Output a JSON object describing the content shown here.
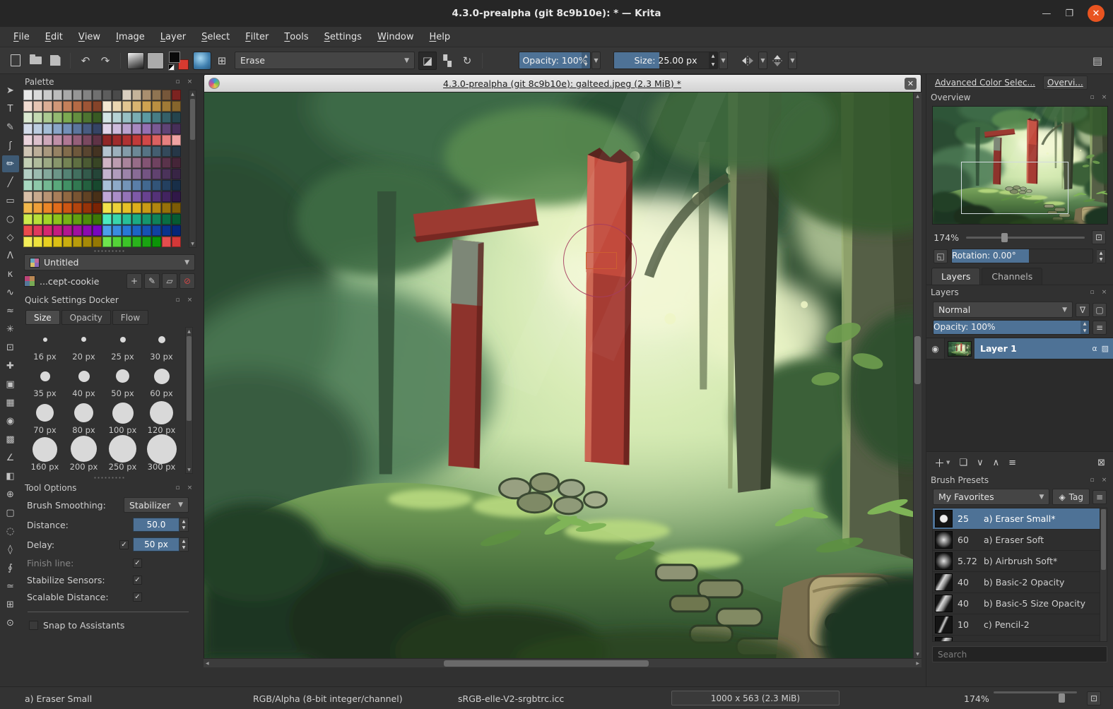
{
  "titlebar": {
    "title": "4.3.0-prealpha (git 8c9b10e): * — Krita"
  },
  "menubar": {
    "items": [
      "File",
      "Edit",
      "View",
      "Image",
      "Layer",
      "Select",
      "Filter",
      "Tools",
      "Settings",
      "Window",
      "Help"
    ]
  },
  "toolbar": {
    "preset_combo": "Erase",
    "opacity": "Opacity: 100%",
    "size": "Size: 25.00 px"
  },
  "toolbox": {
    "tools": [
      {
        "name": "select-shapes-tool",
        "glyph": "➤"
      },
      {
        "name": "text-tool",
        "glyph": "T"
      },
      {
        "name": "edit-shapes-tool",
        "glyph": "✎"
      },
      {
        "name": "calligraphy-tool",
        "glyph": "ʃ"
      },
      {
        "name": "freehand-brush-tool",
        "glyph": "✏",
        "selected": true
      },
      {
        "name": "line-tool",
        "glyph": "╱"
      },
      {
        "name": "rectangle-tool",
        "glyph": "▭"
      },
      {
        "name": "ellipse-tool",
        "glyph": "○"
      },
      {
        "name": "polygon-tool",
        "glyph": "◇"
      },
      {
        "name": "polyline-tool",
        "glyph": "Λ"
      },
      {
        "name": "bezier-curve-tool",
        "glyph": "κ"
      },
      {
        "name": "freehand-path-tool",
        "glyph": "∿"
      },
      {
        "name": "dynamic-brush-tool",
        "glyph": "≈"
      },
      {
        "name": "multibrush-tool",
        "glyph": "✳"
      },
      {
        "name": "transform-tool",
        "glyph": "⊡"
      },
      {
        "name": "move-tool",
        "glyph": "✚"
      },
      {
        "name": "crop-tool",
        "glyph": "▣"
      },
      {
        "name": "gradient-tool",
        "glyph": "▦"
      },
      {
        "name": "color-sampler-tool",
        "glyph": "◉"
      },
      {
        "name": "pattern-edit-tool",
        "glyph": "▩"
      },
      {
        "name": "measure-tool",
        "glyph": "∠"
      },
      {
        "name": "fill-tool",
        "glyph": "◧"
      },
      {
        "name": "assistants-tool",
        "glyph": "⊕"
      },
      {
        "name": "rect-select-tool",
        "glyph": "▢"
      },
      {
        "name": "ellipse-select-tool",
        "glyph": "◌"
      },
      {
        "name": "polygon-select-tool",
        "glyph": "◊"
      },
      {
        "name": "freehand-select-tool",
        "glyph": "∮"
      },
      {
        "name": "similar-select-tool",
        "glyph": "≃"
      },
      {
        "name": "pan-tool",
        "glyph": "⊞"
      },
      {
        "name": "zoom-tool",
        "glyph": "⊙"
      }
    ]
  },
  "palette_docker": {
    "title": "Palette",
    "combo": "Untitled",
    "entry": "...cept-cookie",
    "colors": [
      [
        "#e9e9e9",
        "#dadada",
        "#cbcbcb",
        "#bcbcbc",
        "#a9a9a9",
        "#969696",
        "#838383",
        "#707070",
        "#5d5d5d",
        "#4a4a4a",
        "#d9cfc0",
        "#c4b39a",
        "#a98f6f",
        "#8f7452",
        "#76573a",
        "#7c2320"
      ],
      [
        "#f1dcd2",
        "#e6c5b4",
        "#dbae96",
        "#d09778",
        "#c5805a",
        "#b56a45",
        "#9e5536",
        "#854329",
        "#f3e7d1",
        "#ead6b1",
        "#e1c591",
        "#d8b471",
        "#cfa351",
        "#ba8f41",
        "#a07a36",
        "#86652c"
      ],
      [
        "#dcead2",
        "#c4dab2",
        "#acca92",
        "#94ba72",
        "#7caa52",
        "#648f40",
        "#4e7431",
        "#395a24",
        "#d4e6e6",
        "#b6d3d5",
        "#98c0c4",
        "#7aadb3",
        "#5c9aa2",
        "#477d85",
        "#356069",
        "#25444d"
      ],
      [
        "#d4dcea",
        "#bccde0",
        "#a4bed6",
        "#8aa6c8",
        "#7390b8",
        "#5c769d",
        "#485c81",
        "#354465",
        "#e0d4ea",
        "#cdbbdc",
        "#baa2ce",
        "#a789c0",
        "#9470b2",
        "#795a94",
        "#5f4476",
        "#462f58"
      ],
      [
        "#ead4dc",
        "#dcc0cc",
        "#cea8ba",
        "#c090a8",
        "#b07894",
        "#95607a",
        "#7a4960",
        "#5f3346",
        "#8f2727",
        "#9f2c2c",
        "#b03232",
        "#c13a3a",
        "#d14848",
        "#dc6161",
        "#e68080",
        "#efa3a3"
      ],
      [
        "#cfc4b4",
        "#bcae99",
        "#a9987e",
        "#968264",
        "#826c4c",
        "#6e583c",
        "#594530",
        "#443322",
        "#b4c4cf",
        "#9cb0bc",
        "#849ca9",
        "#6c8896",
        "#567384",
        "#445e70",
        "#344a5b",
        "#263747"
      ],
      [
        "#c4cfb4",
        "#b0bc9c",
        "#9ca984",
        "#88966c",
        "#748354",
        "#5f6f42",
        "#4b5a33",
        "#384525",
        "#cfb4c4",
        "#bc9cb0",
        "#a9849c",
        "#966c88",
        "#835474",
        "#6f4260",
        "#5a334b",
        "#452538"
      ],
      [
        "#b4cfc4",
        "#9cbcb0",
        "#84a99c",
        "#6c9688",
        "#548374",
        "#426f5f",
        "#335a4b",
        "#254538",
        "#c4b4cf",
        "#b09cbc",
        "#9c84a9",
        "#886c96",
        "#745483",
        "#60426f",
        "#4b335a",
        "#382545"
      ],
      [
        "#a8d8c0",
        "#8ec8a9",
        "#74b892",
        "#5aa87b",
        "#429065",
        "#327851",
        "#24603f",
        "#18482e",
        "#a8c0d8",
        "#8eaac8",
        "#7494b8",
        "#5a7ea8",
        "#426890",
        "#325478",
        "#244060",
        "#182e48"
      ],
      [
        "#d8c0a8",
        "#c8aa8e",
        "#b89474",
        "#a87e5a",
        "#906842",
        "#785432",
        "#604224",
        "#483018",
        "#c0a8d8",
        "#aa8ec8",
        "#9474b8",
        "#7e5aa8",
        "#684290",
        "#543278",
        "#422460",
        "#301848"
      ],
      [
        "#f2b84c",
        "#ee9f3a",
        "#ea8628",
        "#e06c1c",
        "#cc5614",
        "#b2440e",
        "#963309",
        "#7a2405",
        "#f2e24c",
        "#ecd13a",
        "#e6c028",
        "#dcae1c",
        "#c99a16",
        "#b08510",
        "#96700a",
        "#7c5b06"
      ],
      [
        "#cdea4c",
        "#b9e03a",
        "#a4d528",
        "#8ec41c",
        "#78b216",
        "#62a010",
        "#4e8c0a",
        "#3c7806",
        "#4ceac0",
        "#3ad5ac",
        "#28c098",
        "#1cab84",
        "#16966e",
        "#108258",
        "#0a6e44",
        "#065a32"
      ],
      [
        "#ea4c4c",
        "#e03a5e",
        "#d52870",
        "#c41c80",
        "#b21690",
        "#a010a0",
        "#8c0ab0",
        "#7806c0",
        "#4c9fea",
        "#3a8ce0",
        "#2878d5",
        "#1c64c4",
        "#1652b2",
        "#1042a0",
        "#0a338c",
        "#062678"
      ],
      [
        "#f4ee5a",
        "#eee23e",
        "#e8d022",
        "#dcc016",
        "#caae10",
        "#b89c0c",
        "#a68a08",
        "#947804",
        "#6ee44e",
        "#54d438",
        "#3cc428",
        "#2ab41c",
        "#1aa412",
        "#0c9408",
        "#e44e4e",
        "#d43838"
      ]
    ]
  },
  "quick_settings": {
    "title": "Quick Settings Docker",
    "tabs": [
      "Size",
      "Opacity",
      "Flow"
    ],
    "active_tab": "Size",
    "sizes": [
      {
        "label": "16 px",
        "d": 6
      },
      {
        "label": "20 px",
        "d": 7
      },
      {
        "label": "25 px",
        "d": 8
      },
      {
        "label": "30 px",
        "d": 10
      },
      {
        "label": "35 px",
        "d": 14
      },
      {
        "label": "40 px",
        "d": 16
      },
      {
        "label": "50 px",
        "d": 19
      },
      {
        "label": "60 px",
        "d": 22
      },
      {
        "label": "70 px",
        "d": 25
      },
      {
        "label": "80 px",
        "d": 27
      },
      {
        "label": "100 px",
        "d": 30
      },
      {
        "label": "120 px",
        "d": 33
      },
      {
        "label": "160 px",
        "d": 35
      },
      {
        "label": "200 px",
        "d": 37
      },
      {
        "label": "250 px",
        "d": 39
      },
      {
        "label": "300 px",
        "d": 42
      }
    ]
  },
  "tool_options": {
    "title": "Tool Options",
    "brush_smoothing_label": "Brush Smoothing:",
    "brush_smoothing_value": "Stabilizer",
    "distance_label": "Distance:",
    "distance_value": "50.0",
    "delay_label": "Delay:",
    "delay_value": "50 px",
    "finish_line_label": "Finish line:",
    "stabilize_label": "Stabilize Sensors:",
    "scalable_label": "Scalable Distance:",
    "snap_label": "Snap to Assistants"
  },
  "subwindow": {
    "title": "4.3.0-prealpha (git 8c9b10e): galteed.jpeg (2.3 MiB) *"
  },
  "overview_panel": {
    "tabs": [
      "Advanced Color Selec...",
      "Overvi..."
    ],
    "title": "Overview",
    "zoom": "174%",
    "rotation": "Rotation: 0.00°"
  },
  "layers_panel": {
    "tabs": [
      "Layers",
      "Channels"
    ],
    "title": "Layers",
    "blend_mode": "Normal",
    "opacity": "Opacity:  100%",
    "layers": [
      {
        "name": "Layer 1"
      }
    ]
  },
  "brush_presets": {
    "title": "Brush Presets",
    "tag_combo": "My Favorites",
    "tag_button": "Tag",
    "search_placeholder": "Search",
    "items": [
      {
        "size": "25",
        "name": "a) Eraser Small*",
        "selected": true,
        "thumb": "dot-hard"
      },
      {
        "size": "60",
        "name": "a) Eraser Soft",
        "thumb": "dot-soft"
      },
      {
        "size": "5.72",
        "name": "b) Airbrush Soft*",
        "thumb": "dot-soft"
      },
      {
        "size": "40",
        "name": "b) Basic-2 Opacity",
        "thumb": "stroke"
      },
      {
        "size": "40",
        "name": "b) Basic-5 Size Opacity",
        "thumb": "stroke"
      },
      {
        "size": "10",
        "name": "c) Pencil-2",
        "thumb": "stroke-thin"
      },
      {
        "size": "",
        "name": "",
        "thumb": "stroke",
        "partial": true
      }
    ]
  },
  "statusbar": {
    "preset": "a) Eraser Small",
    "colorspace": "RGB/Alpha (8-bit integer/channel)",
    "profile": "sRGB-elle-V2-srgbtrc.icc",
    "dimensions": "1000 x 563 (2.3 MiB)",
    "zoom": "174%"
  }
}
